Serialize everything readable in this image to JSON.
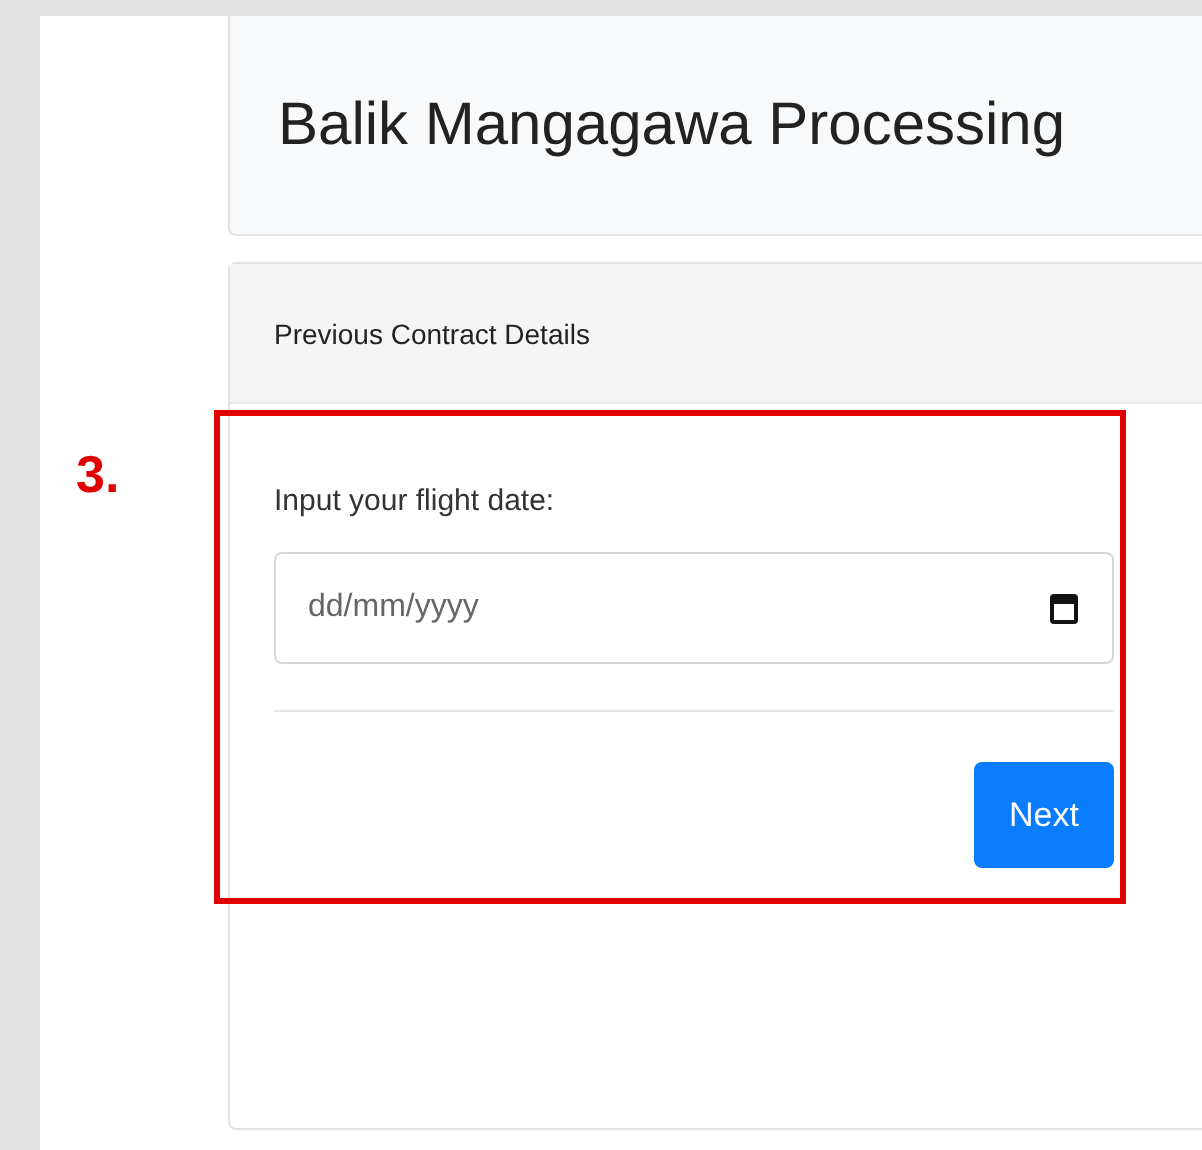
{
  "page_title": "Balik Mangagawa Processing",
  "card": {
    "header": "Previous Contract Details",
    "field": {
      "label": "Input your flight date:",
      "placeholder": "dd/mm/yyyy"
    },
    "button": "Next"
  },
  "annotation": {
    "label": "3."
  }
}
